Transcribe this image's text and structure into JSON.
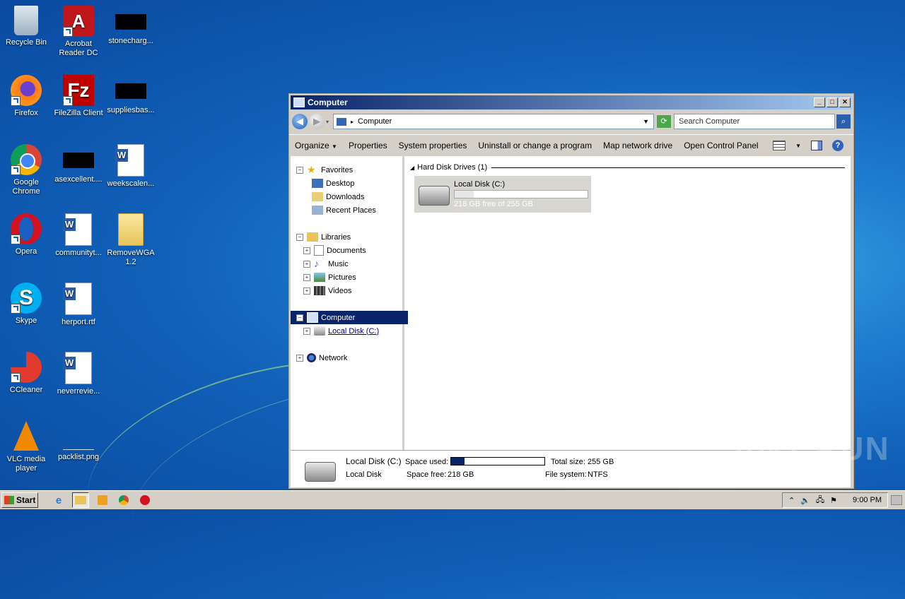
{
  "desktop": {
    "icons": [
      {
        "label": "Recycle Bin",
        "icon": "recycle-bin-icon"
      },
      {
        "label": "Acrobat Reader DC",
        "icon": "acrobat-icon"
      },
      {
        "label": "stonecharg...",
        "icon": "redacted-file-icon"
      },
      {
        "label": "Firefox",
        "icon": "firefox-icon"
      },
      {
        "label": "FileZilla Client",
        "icon": "filezilla-icon"
      },
      {
        "label": "suppliesbas...",
        "icon": "redacted-file-icon"
      },
      {
        "label": "Google Chrome",
        "icon": "chrome-icon"
      },
      {
        "label": "asexcellent....",
        "icon": "redacted-file-icon"
      },
      {
        "label": "weekscalen...",
        "icon": "word-doc-icon"
      },
      {
        "label": "Opera",
        "icon": "opera-icon"
      },
      {
        "label": "communityt...",
        "icon": "word-doc-icon"
      },
      {
        "label": "RemoveWGA 1.2",
        "icon": "folder-icon"
      },
      {
        "label": "Skype",
        "icon": "skype-icon"
      },
      {
        "label": "herport.rtf",
        "icon": "word-doc-icon"
      },
      {
        "label": "CCleaner",
        "icon": "ccleaner-icon"
      },
      {
        "label": "neverrevie...",
        "icon": "word-doc-icon"
      },
      {
        "label": "VLC media player",
        "icon": "vlc-icon"
      },
      {
        "label": "packlist.png",
        "icon": "image-file-icon"
      }
    ],
    "watermark": "ANY RUN"
  },
  "window": {
    "title": "Computer",
    "address": "Computer",
    "search_placeholder": "Search Computer",
    "commands": [
      "Organize",
      "Properties",
      "System properties",
      "Uninstall or change a program",
      "Map network drive",
      "Open Control Panel"
    ],
    "nav": {
      "favorites": "Favorites",
      "desktop": "Desktop",
      "downloads": "Downloads",
      "recent": "Recent Places",
      "libraries": "Libraries",
      "documents": "Documents",
      "music": "Music",
      "pictures": "Pictures",
      "videos": "Videos",
      "computer": "Computer",
      "local_disk": "Local Disk (C:)",
      "network": "Network"
    },
    "group_header": "Hard Disk Drives (1)",
    "drive": {
      "name": "Local Disk (C:)",
      "free_text": "218 GB free of 255 GB",
      "used_fraction": 0.145
    },
    "details": {
      "name": "Local Disk (C:)",
      "type": "Local Disk",
      "space_used_label": "Space used:",
      "space_free_label": "Space free:",
      "space_free": "218 GB",
      "total_size_label": "Total size:",
      "total_size": "255 GB",
      "fs_label": "File system:",
      "fs": "NTFS",
      "used_fraction": 0.145
    }
  },
  "taskbar": {
    "start": "Start",
    "clock": "9:00 PM"
  }
}
